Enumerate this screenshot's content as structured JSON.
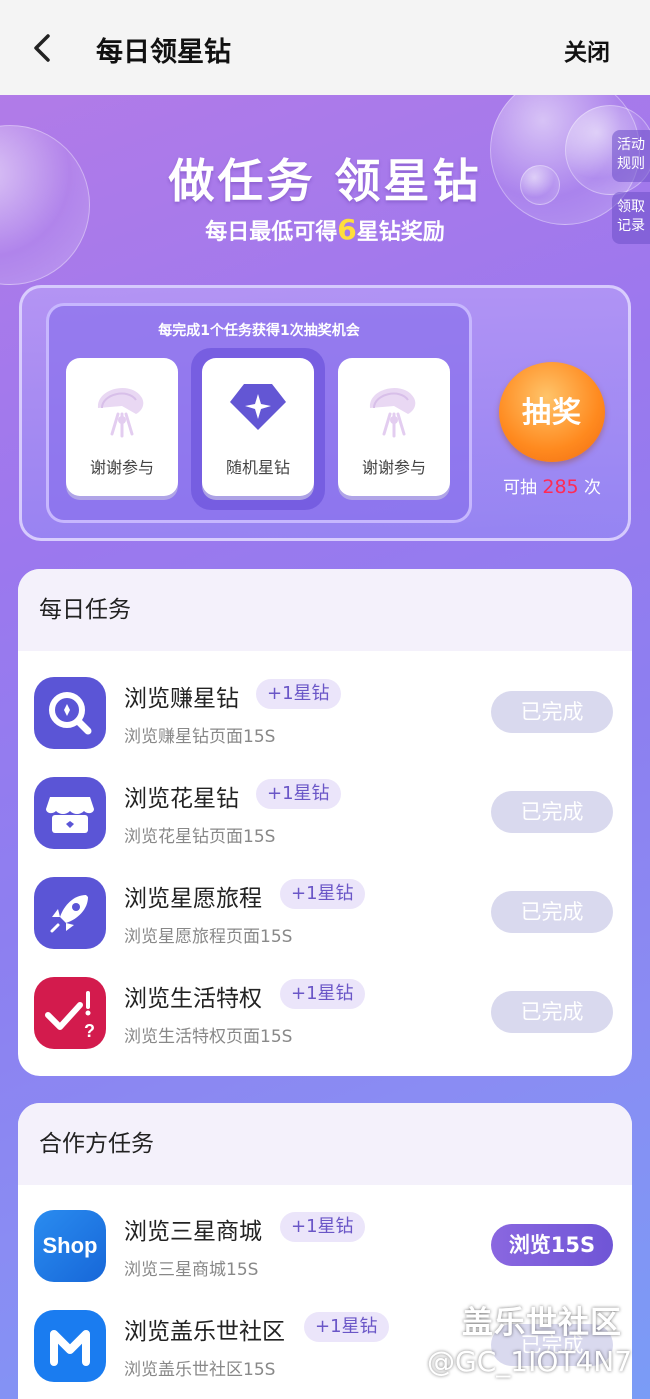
{
  "header": {
    "title": "每日领星钻",
    "close_label": "关闭"
  },
  "side_tabs": {
    "rules": "活动\n规则",
    "records": "领取\n记录"
  },
  "hero": {
    "title": "做任务 领星钻",
    "sub_prefix": "每日最低可得",
    "sub_number": "6",
    "sub_suffix": "星钻奖励"
  },
  "lottery": {
    "caption": "每完成1个任务获得1次抽奖机会",
    "prizes": [
      {
        "label": "谢谢参与",
        "icon": "thanks-icon"
      },
      {
        "label": "随机星钻",
        "icon": "diamond-icon"
      },
      {
        "label": "谢谢参与",
        "icon": "thanks-icon"
      }
    ],
    "draw_label": "抽奖",
    "count_prefix": "可抽",
    "count_value": "285",
    "count_suffix": "次"
  },
  "daily": {
    "title": "每日任务",
    "tasks": [
      {
        "title": "浏览赚星钻",
        "badge": "+1星钻",
        "sub": "浏览赚星钻页面15S",
        "status": "已完成",
        "icon": "search-coin-icon"
      },
      {
        "title": "浏览花星钻",
        "badge": "+1星钻",
        "sub": "浏览花星钻页面15S",
        "status": "已完成",
        "icon": "store-icon"
      },
      {
        "title": "浏览星愿旅程",
        "badge": "+1星钻",
        "sub": "浏览星愿旅程页面15S",
        "status": "已完成",
        "icon": "rocket-icon"
      },
      {
        "title": "浏览生活特权",
        "badge": "+1星钻",
        "sub": "浏览生活特权页面15S",
        "status": "已完成",
        "icon": "check-question-icon"
      }
    ]
  },
  "partner": {
    "title": "合作方任务",
    "tasks": [
      {
        "title": "浏览三星商城",
        "badge": "+1星钻",
        "sub": "浏览三星商城15S",
        "status": "浏览15S",
        "icon": "shop-icon",
        "icon_text": "Shop"
      },
      {
        "title": "浏览盖乐世社区",
        "badge": "+1星钻",
        "sub": "浏览盖乐世社区15S",
        "status": "已完成",
        "icon": "members-icon"
      }
    ]
  },
  "watermark": {
    "line1": "盖乐世社区",
    "line2": "@GC_1IOT4N7"
  },
  "colors": {
    "accent": "#7b5ce0",
    "draw_button": "#ff8a1f",
    "count": "#ff2a55",
    "highlight_number": "#ffde3b"
  }
}
